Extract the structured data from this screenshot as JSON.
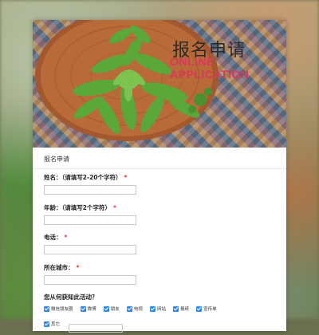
{
  "banner": {
    "title_cn": "报名申请",
    "title_en": "ONLINE APPLICATION"
  },
  "form": {
    "header": "报名申请",
    "fields": [
      {
        "label": "姓名：（请填写2-20个字符）",
        "required": "*",
        "value": ""
      },
      {
        "label": "年龄：（请填写2个字符）",
        "required": "*",
        "value": ""
      },
      {
        "label": "电话：",
        "required": "*",
        "value": ""
      },
      {
        "label": "所在城市：",
        "required": "*",
        "value": ""
      }
    ],
    "source": {
      "label": "您从何获知此活动？",
      "options": [
        {
          "label": "微信朋友圈",
          "checked": true
        },
        {
          "label": "微博",
          "checked": true
        },
        {
          "label": "朋友",
          "checked": true
        },
        {
          "label": "电视",
          "checked": true
        },
        {
          "label": "网站",
          "checked": true
        },
        {
          "label": "报纸",
          "checked": true
        },
        {
          "label": "宣传单",
          "checked": true
        },
        {
          "label": "其它",
          "checked": true
        }
      ],
      "other_value": ""
    }
  },
  "colors": {
    "accent": "#2d8ceb",
    "required": "#e33333",
    "title_en": "#d9385b"
  }
}
